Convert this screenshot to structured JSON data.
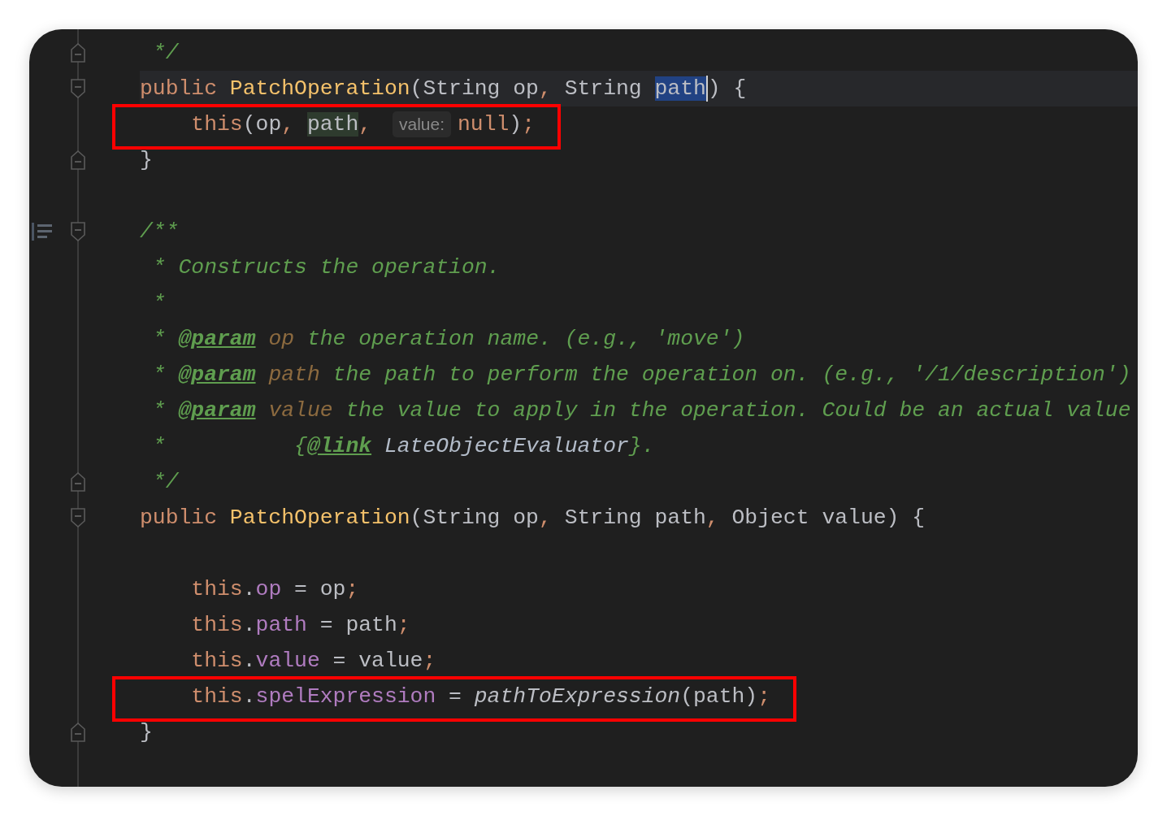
{
  "editor": {
    "lines": [
      {
        "kind": "code",
        "fold_end": true,
        "tokens": [
          {
            "text": " */",
            "kind": "comment"
          }
        ]
      },
      {
        "kind": "code",
        "fold_start": true,
        "caret_line": true,
        "tokens": [
          {
            "text": "public ",
            "kind": "keyword"
          },
          {
            "text": "PatchOperation",
            "kind": "method"
          },
          {
            "text": "(String op",
            "kind": "plain"
          },
          {
            "text": ",",
            "kind": "punct"
          },
          {
            "text": " String ",
            "kind": "plain"
          },
          {
            "text": "path",
            "kind": "plain",
            "in_selection": true,
            "caret": true
          },
          {
            "text": ") {",
            "kind": "plain"
          }
        ]
      },
      {
        "kind": "code",
        "boxed": true,
        "tokens": [
          {
            "text": "    this",
            "kind": "keyword"
          },
          {
            "text": "(op",
            "kind": "plain"
          },
          {
            "text": ", ",
            "kind": "punct"
          },
          {
            "text": "path",
            "kind": "plain",
            "usage_highlight": true
          },
          {
            "text": ", ",
            "kind": "punct"
          },
          {
            "text": "value:",
            "kind": "hint"
          },
          {
            "text": "null",
            "kind": "keyword"
          },
          {
            "text": ")",
            "kind": "plain"
          },
          {
            "text": ";",
            "kind": "punct"
          }
        ]
      },
      {
        "kind": "code",
        "fold_end": true,
        "tokens": [
          {
            "text": "}",
            "kind": "plain"
          }
        ]
      },
      {
        "kind": "blank"
      },
      {
        "kind": "code",
        "fold_start": true,
        "doc_toggle": true,
        "tokens": [
          {
            "text": "/**",
            "kind": "comment"
          }
        ]
      },
      {
        "kind": "code",
        "tokens": [
          {
            "text": " * Constructs the operation.",
            "kind": "comment"
          }
        ]
      },
      {
        "kind": "code",
        "tokens": [
          {
            "text": " *",
            "kind": "comment"
          }
        ]
      },
      {
        "kind": "code",
        "tokens": [
          {
            "text": " * ",
            "kind": "comment"
          },
          {
            "text": "@param",
            "kind": "doctag"
          },
          {
            "text": " op",
            "kind": "docparam"
          },
          {
            "text": " the operation name. (e.g., 'move')",
            "kind": "comment"
          }
        ]
      },
      {
        "kind": "code",
        "tokens": [
          {
            "text": " * ",
            "kind": "comment"
          },
          {
            "text": "@param",
            "kind": "doctag"
          },
          {
            "text": " path",
            "kind": "docparam"
          },
          {
            "text": " the path to perform the operation on. (e.g., '/1/description')",
            "kind": "comment"
          }
        ]
      },
      {
        "kind": "code",
        "tokens": [
          {
            "text": " * ",
            "kind": "comment"
          },
          {
            "text": "@param",
            "kind": "doctag"
          },
          {
            "text": " value",
            "kind": "docparam"
          },
          {
            "text": " the value to apply in the operation. Could be an actual value",
            "kind": "comment"
          }
        ]
      },
      {
        "kind": "code",
        "tokens": [
          {
            "text": " *          {",
            "kind": "comment"
          },
          {
            "text": "@link",
            "kind": "doctag"
          },
          {
            "text": " LateObjectEvaluator",
            "kind": "docref"
          },
          {
            "text": "}.",
            "kind": "comment"
          }
        ]
      },
      {
        "kind": "code",
        "fold_end": true,
        "tokens": [
          {
            "text": " */",
            "kind": "comment"
          }
        ]
      },
      {
        "kind": "code",
        "fold_start": true,
        "tokens": [
          {
            "text": "public ",
            "kind": "keyword"
          },
          {
            "text": "PatchOperation",
            "kind": "method"
          },
          {
            "text": "(String op",
            "kind": "plain"
          },
          {
            "text": ",",
            "kind": "punct"
          },
          {
            "text": " String path",
            "kind": "plain"
          },
          {
            "text": ",",
            "kind": "punct"
          },
          {
            "text": " Object value) {",
            "kind": "plain"
          }
        ]
      },
      {
        "kind": "blank"
      },
      {
        "kind": "code",
        "tokens": [
          {
            "text": "    this",
            "kind": "keyword"
          },
          {
            "text": ".",
            "kind": "plain"
          },
          {
            "text": "op",
            "kind": "field"
          },
          {
            "text": " = op",
            "kind": "plain"
          },
          {
            "text": ";",
            "kind": "punct"
          }
        ]
      },
      {
        "kind": "code",
        "tokens": [
          {
            "text": "    this",
            "kind": "keyword"
          },
          {
            "text": ".",
            "kind": "plain"
          },
          {
            "text": "path",
            "kind": "field"
          },
          {
            "text": " = path",
            "kind": "plain"
          },
          {
            "text": ";",
            "kind": "punct"
          }
        ]
      },
      {
        "kind": "code",
        "tokens": [
          {
            "text": "    this",
            "kind": "keyword"
          },
          {
            "text": ".",
            "kind": "plain"
          },
          {
            "text": "value",
            "kind": "field"
          },
          {
            "text": " = value",
            "kind": "plain"
          },
          {
            "text": ";",
            "kind": "punct"
          }
        ]
      },
      {
        "kind": "code",
        "boxed": true,
        "tokens": [
          {
            "text": "    this",
            "kind": "keyword"
          },
          {
            "text": ".",
            "kind": "plain"
          },
          {
            "text": "spelExpression",
            "kind": "field"
          },
          {
            "text": " = ",
            "kind": "plain"
          },
          {
            "text": "pathToExpression",
            "kind": "call"
          },
          {
            "text": "(path)",
            "kind": "plain"
          },
          {
            "text": ";",
            "kind": "punct"
          }
        ]
      },
      {
        "kind": "code",
        "fold_end": true,
        "tokens": [
          {
            "text": "}",
            "kind": "plain"
          }
        ]
      },
      {
        "kind": "blank"
      }
    ]
  }
}
